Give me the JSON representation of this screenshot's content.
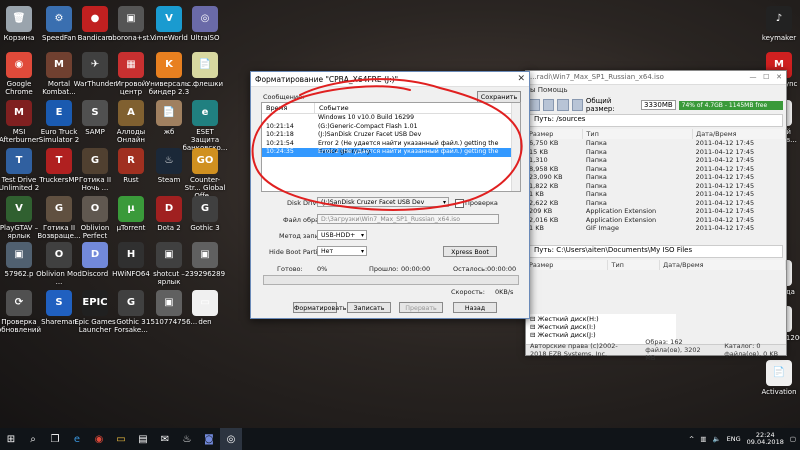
{
  "desktop_icons_left": [
    {
      "label": "Корзина",
      "icon": "recycle-bin-icon",
      "color": "#9aa4ad",
      "glyph": "🗑"
    },
    {
      "label": "SpeedFan",
      "icon": "speedfan-icon",
      "color": "#3a6fb0",
      "glyph": "⚙"
    },
    {
      "label": "Bandicam",
      "icon": "bandicam-icon",
      "color": "#c02020",
      "glyph": "●"
    },
    {
      "label": "oborona+st...",
      "icon": "app-icon",
      "color": "#555",
      "glyph": "▣"
    },
    {
      "label": "VimeWorld",
      "icon": "vimeworld-icon",
      "color": "#1a9bd0",
      "glyph": "V"
    },
    {
      "label": "UltraISO",
      "icon": "ultraiso-icon",
      "color": "#6a6aa8",
      "glyph": "◎"
    },
    {
      "label": "Google Chrome",
      "icon": "chrome-icon",
      "color": "#e04a3a",
      "glyph": "◉"
    },
    {
      "label": "Mortal Kombat...",
      "icon": "game-icon",
      "color": "#704030",
      "glyph": "M"
    },
    {
      "label": "WarThunder",
      "icon": "warthunder-icon",
      "color": "#404040",
      "glyph": "✈"
    },
    {
      "label": "Игровой центр",
      "icon": "game-center-icon",
      "color": "#c83030",
      "glyph": "▦"
    },
    {
      "label": "Универсаль... биндер 2.3 ...",
      "icon": "binder-icon",
      "color": "#e88020",
      "glyph": "K"
    },
    {
      "label": "с флешки",
      "icon": "file-icon",
      "color": "#d8d8a0",
      "glyph": "📄"
    },
    {
      "label": "MSI Afterburner",
      "icon": "msi-afterburner-icon",
      "color": "#802020",
      "glyph": "M"
    },
    {
      "label": "Euro Truck Simulator 2",
      "icon": "ets2-icon",
      "color": "#1a5ab0",
      "glyph": "E"
    },
    {
      "label": "SAMP",
      "icon": "samp-icon",
      "color": "#505050",
      "glyph": "S"
    },
    {
      "label": "Аллоды Онлайн",
      "icon": "allods-icon",
      "color": "#806030",
      "glyph": "A"
    },
    {
      "label": "жб",
      "icon": "file-icon",
      "color": "#a08060",
      "glyph": "📄"
    },
    {
      "label": "ESET Защита банковско...",
      "icon": "eset-icon",
      "color": "#208080",
      "glyph": "e"
    },
    {
      "label": "Test Drive Unlimited 2",
      "icon": "tdu2-icon",
      "color": "#3060a0",
      "glyph": "T"
    },
    {
      "label": "TruckersMP",
      "icon": "truckersmp-icon",
      "color": "#b02020",
      "glyph": "T"
    },
    {
      "label": "Готика II Ночь ...",
      "icon": "gothic-icon",
      "color": "#504030",
      "glyph": "G"
    },
    {
      "label": "Rust",
      "icon": "rust-icon",
      "color": "#a03020",
      "glyph": "R"
    },
    {
      "label": "Steam",
      "icon": "steam-icon",
      "color": "#1b2838",
      "glyph": "♨"
    },
    {
      "label": "Counter-Str... Global Offe...",
      "icon": "csgo-icon",
      "color": "#d09020",
      "glyph": "GO"
    },
    {
      "label": "PlayGTAV – ярлык",
      "icon": "gtav-icon",
      "color": "#306030",
      "glyph": "V"
    },
    {
      "label": "Готика II Возвраще...",
      "icon": "gothic-icon",
      "color": "#605040",
      "glyph": "G"
    },
    {
      "label": "Oblivion Perfect",
      "icon": "oblivion-icon",
      "color": "#605850",
      "glyph": "O"
    },
    {
      "label": "µTorrent",
      "icon": "utorrent-icon",
      "color": "#3a9a3a",
      "glyph": "µ"
    },
    {
      "label": "Dota 2",
      "icon": "dota2-icon",
      "color": "#a02020",
      "glyph": "D"
    },
    {
      "label": "Gothic 3",
      "icon": "gothic3-icon",
      "color": "#404040",
      "glyph": "G"
    },
    {
      "label": "57962.p",
      "icon": "image-file-icon",
      "color": "#506070",
      "glyph": "▣"
    },
    {
      "label": "Oblivion Mod ...",
      "icon": "oblivion-icon",
      "color": "#404040",
      "glyph": "O"
    },
    {
      "label": "Discord",
      "icon": "discord-icon",
      "color": "#7289da",
      "glyph": "D"
    },
    {
      "label": "HWiNFO64",
      "icon": "hwinfo-icon",
      "color": "#303030",
      "glyph": "H"
    },
    {
      "label": "shotcut – ярлык",
      "icon": "shotcut-icon",
      "color": "#404040",
      "glyph": "▣"
    },
    {
      "label": "239296289",
      "icon": "image-file-icon",
      "color": "#606060",
      "glyph": "▣"
    },
    {
      "label": "Проверка обновлений",
      "icon": "update-icon",
      "color": "#505050",
      "glyph": "⟳"
    },
    {
      "label": "Shareman",
      "icon": "shareman-icon",
      "color": "#2060c0",
      "glyph": "S"
    },
    {
      "label": "Epic Games Launcher",
      "icon": "epic-games-icon",
      "color": "#202020",
      "glyph": "EPIC"
    },
    {
      "label": "Gothic 3 Forsake...",
      "icon": "gothic3-icon",
      "color": "#404040",
      "glyph": "G"
    },
    {
      "label": "1510774756...",
      "icon": "image-file-icon",
      "color": "#606060",
      "glyph": "▣"
    },
    {
      "label": "den",
      "icon": "file-icon",
      "color": "#f0f0f0",
      "glyph": "▭"
    }
  ],
  "desktop_icons_right": [
    {
      "label": "keymaker",
      "icon": "keymaker-icon",
      "color": "#222",
      "glyph": "♪"
    },
    {
      "label": "MEGAsync",
      "icon": "megasync-icon",
      "color": "#d02020",
      "glyph": "M"
    },
    {
      "label": "Новый текстов...",
      "icon": "text-file-icon",
      "color": "#f0f0f0",
      "glyph": "📄"
    },
    {
      "label": "команда",
      "icon": "text-file-icon",
      "color": "#f0f0f0",
      "glyph": "▭"
    },
    {
      "label": "3_1600x1200",
      "icon": "image-file-icon",
      "color": "#f0f0f0",
      "glyph": "▭"
    },
    {
      "label": "Activation",
      "icon": "text-file-icon",
      "color": "#f0f0f0",
      "glyph": "📄"
    }
  ],
  "ultraiso": {
    "title": "...radi\\Win7_Max_SP1_Russian_x64.iso",
    "menu": "ы   Помощь",
    "total_size_label": "Общий размер:",
    "total_size_value": "3330MB",
    "usage_bar": "74% of 4.7GB - 1145MB free",
    "path1_label": "Путь:",
    "path1": "/sources",
    "columns": [
      "Размер",
      "Тип",
      "Дата/Время"
    ],
    "rows_top": [
      [
        "6,750 KB",
        "Папка",
        "2011-04-12 17:45"
      ],
      [
        "15 KB",
        "Папка",
        "2011-04-12 17:45"
      ],
      [
        "1,310",
        "Папка",
        "2011-04-12 17:45"
      ],
      [
        "8,958 KB",
        "Папка",
        "2011-04-12 17:45"
      ],
      [
        "23,090 KB",
        "Папка",
        "2011-04-12 17:45"
      ],
      [
        "1,822 KB",
        "Папка",
        "2011-04-12 17:45"
      ],
      [
        "1 KB",
        "Папка",
        "2011-04-12 17:45"
      ],
      [
        "2,622 KB",
        "Папка",
        "2011-04-12 17:45"
      ],
      [
        "209 KB",
        "Application Extension",
        "2011-04-12 17:45"
      ],
      [
        "2,016 KB",
        "Application Extension",
        "2011-04-12 17:45"
      ],
      [
        "1 KB",
        "GIF Image",
        "2011-04-12 17:45"
      ]
    ],
    "path2_label": "Путь:",
    "path2": "C:\\Users\\aiten\\Documents\\My ISO Files",
    "rows_bottom": [
      [
        "Размер",
        "Тип",
        "Дата/Время"
      ]
    ],
    "tree": [
      "Жесткий диск(H:)",
      "Жесткий диск(I:)",
      "Жесткий диск(J:)"
    ],
    "status_copyright": "Авторские права (c)2002-2018 EZB Systems, Inc.",
    "status_image": "Образ: 162 файла(ов), 3202 MB",
    "status_catalog": "Каталог: 0 файла(ов), 0 KB"
  },
  "dialog": {
    "title": "Форматирование \"CPBA_X64FRE (J:)\"",
    "messages_label": "Сообщение:",
    "save_button": "Сохранить",
    "log_columns": [
      "Время",
      "Событие"
    ],
    "log_rows": [
      {
        "time": "",
        "event": "Windows 10 v10.0 Build 16299",
        "selected": false
      },
      {
        "time": "10:21:14",
        "event": "(G:)Generic-Compact Flash  1.01",
        "selected": false
      },
      {
        "time": "10:21:18",
        "event": "(J:)SanDisk Cruzer Facet USB Dev",
        "selected": false
      },
      {
        "time": "10:21:54",
        "event": "Error 2 (Не удается найти указанный файл.) getting the device geometry.",
        "selected": false
      },
      {
        "time": "10:24:35",
        "event": "Error 2 (Не удается найти указанный файл.) getting the device geometry.",
        "selected": true
      }
    ],
    "disk_drive_label": "Disk Drive:",
    "disk_drive_value": "(J:)SanDisk Cruzer Facet USB Dev",
    "verify_label": "Проверка",
    "image_file_label": "Файл образа:",
    "image_file_value": "D:\\Загрузки\\Win7_Max_SP1_Russian_x64.iso",
    "write_method_label": "Метод записи:",
    "write_method_value": "USB-HDD+",
    "hide_boot_label": "Hide Boot Partition:",
    "hide_boot_value": "Нет",
    "xpress_boot_button": "Xpress Boot",
    "done_label": "Готово:",
    "done_value": "0%",
    "elapsed_label": "Прошло:",
    "elapsed_value": "00:00:00",
    "remaining_label": "Осталось:",
    "remaining_value": "00:00:00",
    "speed_label": "Скорость:",
    "speed_value": "0KB/s",
    "progress_fraction": 0,
    "buttons": {
      "format": "Форматировать",
      "write": "Записать",
      "abort": "Прервать",
      "back": "Назад"
    }
  },
  "annotation_color": "#e02020",
  "taskbar": {
    "language": "ENG",
    "time": "22:24",
    "date": "09.04.2018"
  }
}
